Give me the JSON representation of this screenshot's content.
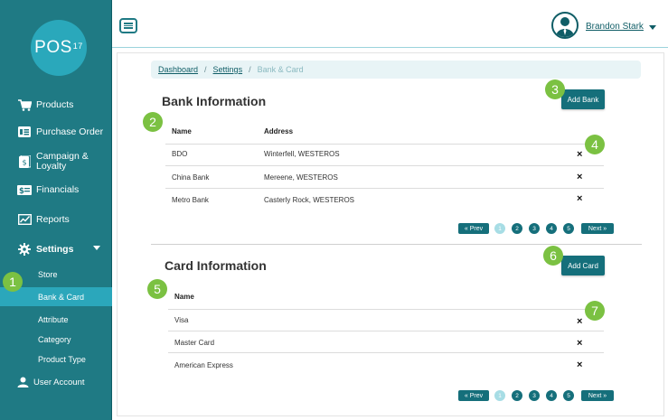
{
  "app": {
    "logo": "POS",
    "logo_sup": "17"
  },
  "sidebar": {
    "items": [
      {
        "label": "Products",
        "icon": "cart-icon"
      },
      {
        "label": "Purchase Order",
        "icon": "purchase-order-icon"
      },
      {
        "label": "Campaign &\nLoyalty",
        "icon": "campaign-icon"
      },
      {
        "label": "Financials",
        "icon": "financials-icon"
      },
      {
        "label": "Reports",
        "icon": "reports-icon"
      },
      {
        "label": "Settings",
        "icon": "gear-icon"
      },
      {
        "label": "User Account",
        "icon": "user-icon"
      }
    ],
    "settings_sub": [
      "Store",
      "Bank & Card",
      "Attribute",
      "Category",
      "Product Type"
    ]
  },
  "header": {
    "user_name": "Brandon Stark"
  },
  "breadcrumb": {
    "items": [
      "Dashboard",
      "Settings",
      "Bank & Card"
    ]
  },
  "bank": {
    "title": "Bank Information",
    "add_label": "Add Bank",
    "col_name": "Name",
    "col_address": "Address",
    "rows": [
      {
        "name": "BDO",
        "address": "Winterfell, WESTEROS"
      },
      {
        "name": "China Bank",
        "address": "Mereene, WESTEROS"
      },
      {
        "name": "Metro Bank",
        "address": "Casterly Rock, WESTEROS"
      }
    ]
  },
  "card": {
    "title": "Card Information",
    "add_label": "Add Card",
    "col_name": "Name",
    "rows": [
      {
        "name": "Visa"
      },
      {
        "name": "Master Card"
      },
      {
        "name": "American Express"
      }
    ]
  },
  "pagination": {
    "prev": "« Prev",
    "next": "Next »",
    "pages": [
      "1",
      "2",
      "3",
      "4",
      "5"
    ],
    "active": "1"
  },
  "delete_glyph": "×",
  "markers": [
    "1",
    "2",
    "3",
    "4",
    "5",
    "6",
    "7"
  ],
  "colors": {
    "sidebar": "#1f7a84",
    "accent": "#156f7b",
    "highlight": "#2ba7bb",
    "marker": "#7bc142"
  }
}
